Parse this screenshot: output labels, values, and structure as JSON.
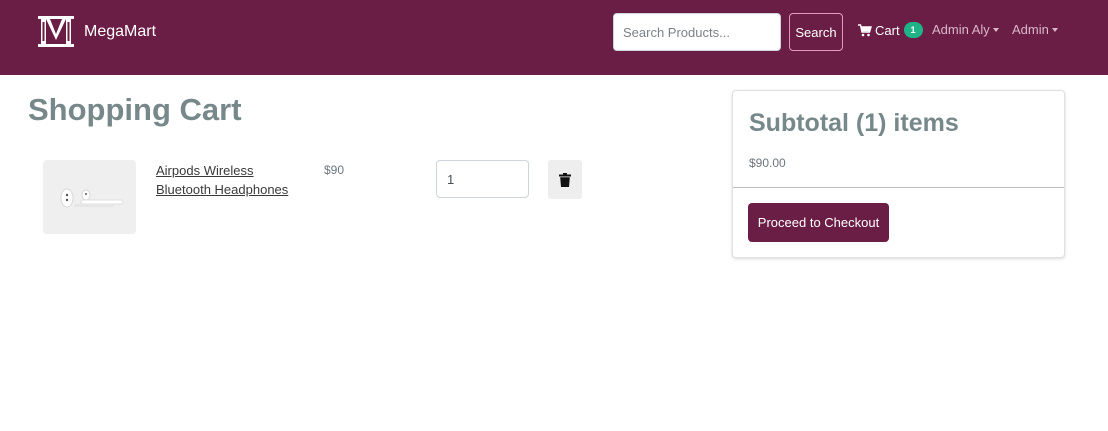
{
  "header": {
    "brand": "MegaMart",
    "search_placeholder": "Search Products...",
    "search_button": "Search",
    "cart_label": "Cart",
    "cart_count": "1",
    "user_menu": "Admin Aly",
    "admin_menu": "Admin"
  },
  "cart": {
    "title": "Shopping Cart",
    "items": [
      {
        "name": "Airpods Wireless Bluetooth Headphones",
        "price": "$90",
        "quantity": "1",
        "image": "airpods-image"
      }
    ]
  },
  "summary": {
    "title": "Subtotal (1) items",
    "amount": "$90.00",
    "checkout_button": "Proceed to Checkout"
  },
  "colors": {
    "brand": "#6b1e45",
    "badge": "#1fb388",
    "heading": "#77888a"
  },
  "icons": {
    "logo": "m-pillar-logo",
    "cart": "cart-icon",
    "delete": "trash-icon"
  }
}
